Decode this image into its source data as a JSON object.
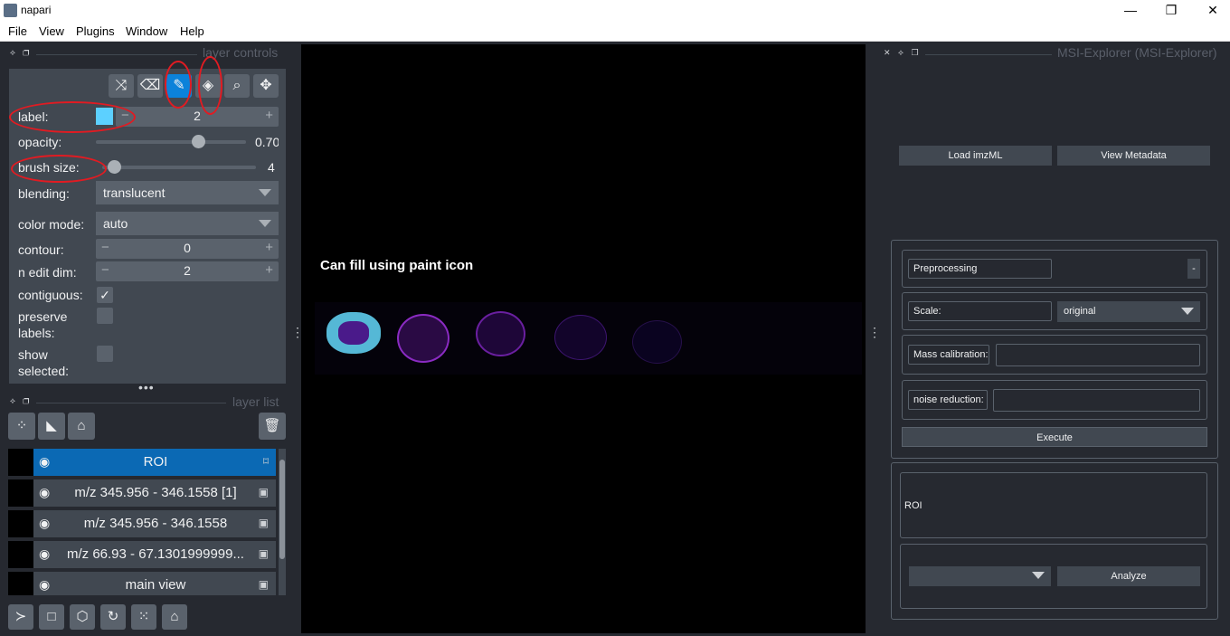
{
  "window": {
    "title": "napari",
    "minimize": "—",
    "maximize": "❐",
    "close": "✕"
  },
  "menu": [
    "File",
    "View",
    "Plugins",
    "Window",
    "Help"
  ],
  "layer_controls": {
    "header": "layer controls",
    "tools": [
      "shuffle-icon",
      "eraser-icon",
      "paintbrush-icon",
      "fill-bucket-icon",
      "color-picker-icon",
      "pan-zoom-icon"
    ],
    "active_tool": "paintbrush-icon",
    "label": {
      "label": "label:",
      "value": "2",
      "color": "#5cd0ff"
    },
    "opacity": {
      "label": "opacity:",
      "value": "0.70",
      "fraction": 0.7
    },
    "brush_size": {
      "label": "brush size:",
      "value": "4",
      "fraction": 0.04
    },
    "blending": {
      "label": "blending:",
      "value": "translucent"
    },
    "color_mode": {
      "label": "color mode:",
      "value": "auto"
    },
    "contour": {
      "label": "contour:",
      "value": "0"
    },
    "n_edit_dim": {
      "label": "n edit dim:",
      "value": "2"
    },
    "contiguous": {
      "label": "contiguous:",
      "checked": true,
      "check": "✓"
    },
    "preserve_labels": {
      "label1": "preserve",
      "label2": "labels:",
      "checked": false
    },
    "show_selected": {
      "label1": "show",
      "label2": "selected:",
      "checked": false
    },
    "minus": "−",
    "plus": "+"
  },
  "layer_list": {
    "header": "layer list",
    "layers": [
      {
        "name": "ROI",
        "type_icon": "tag-icon",
        "selected": true
      },
      {
        "name": "m/z 345.956 - 346.1558 [1]",
        "type_icon": "image-icon",
        "selected": false
      },
      {
        "name": "m/z 345.956 - 346.1558",
        "type_icon": "image-icon",
        "selected": false
      },
      {
        "name": "m/z 66.93 - 67.1301999999...",
        "type_icon": "image-icon",
        "selected": false
      },
      {
        "name": "main view",
        "type_icon": "image-icon",
        "selected": false
      }
    ]
  },
  "canvas": {
    "annotation": "Can fill using paint icon"
  },
  "msi_explorer": {
    "header": "MSI-Explorer (MSI-Explorer)",
    "load_button": "Load imzML",
    "metadata_button": "View Metadata",
    "preprocessing": "Preprocessing",
    "collapse": "-",
    "scale_label": "Scale:",
    "scale_value": "original",
    "mass_calibration_label": "Mass calibration:",
    "noise_reduction_label": "noise reduction:",
    "execute_button": "Execute",
    "roi_text": "ROI",
    "analyze_button": "Analyze"
  },
  "colors": {
    "accent": "#0b82da",
    "selected_layer": "#0b69b4",
    "annotation_ring": "#e11b22",
    "label_color": "#5cd0ff"
  }
}
